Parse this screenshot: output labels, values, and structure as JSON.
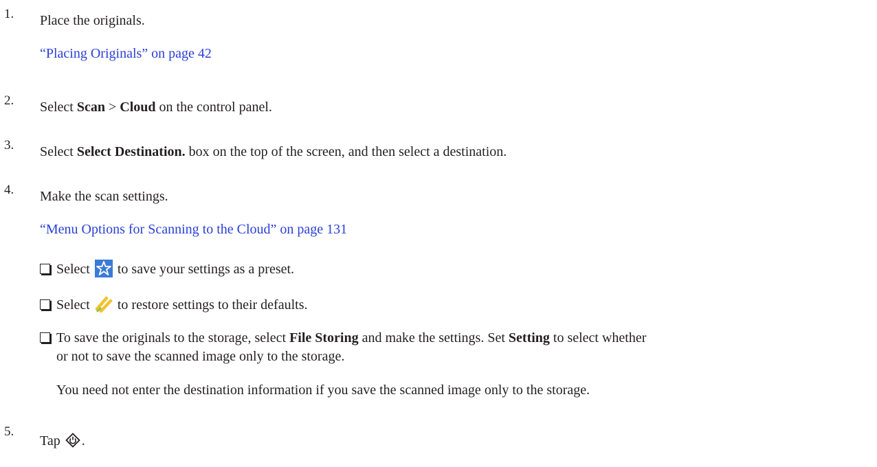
{
  "steps": [
    {
      "number": "1.",
      "text": "Place the originals.",
      "link": "“Placing Originals” on page 42"
    },
    {
      "number": "2.",
      "pre": "Select ",
      "b1": "Scan",
      "mid": " > ",
      "b2": "Cloud",
      "post": " on the control panel."
    },
    {
      "number": "3.",
      "pre": "Select ",
      "b1": "Select Destination.",
      "post": " box on the top of the screen, and then select a destination."
    },
    {
      "number": "4.",
      "text": "Make the scan settings.",
      "link": "“Menu Options for Scanning to the Cloud” on page 131"
    },
    {
      "number": "5.",
      "pre": "Tap ",
      "post": "."
    }
  ],
  "bullets": {
    "preset": {
      "pre": "Select ",
      "post": " to save your settings as a preset.",
      "icon": "star-icon"
    },
    "defaults": {
      "pre": "Select ",
      "post": " to restore settings to their defaults.",
      "icon": "restore-icon"
    },
    "storing": {
      "pre": "To save the originals to the storage, select ",
      "b1": "File Storing",
      "mid": " and make the settings. Set ",
      "b2": "Setting",
      "post": " to select whether",
      "line2": "or not to save the scanned image only to the storage.",
      "note": "You need not enter the destination information if you save the scanned image only to the storage."
    }
  },
  "colors": {
    "link": "#2a3fd6",
    "text": "#231f20",
    "star": "#3b7bd6",
    "restore": "#f2c230"
  },
  "icons": {
    "start": "start-diamond-icon"
  }
}
